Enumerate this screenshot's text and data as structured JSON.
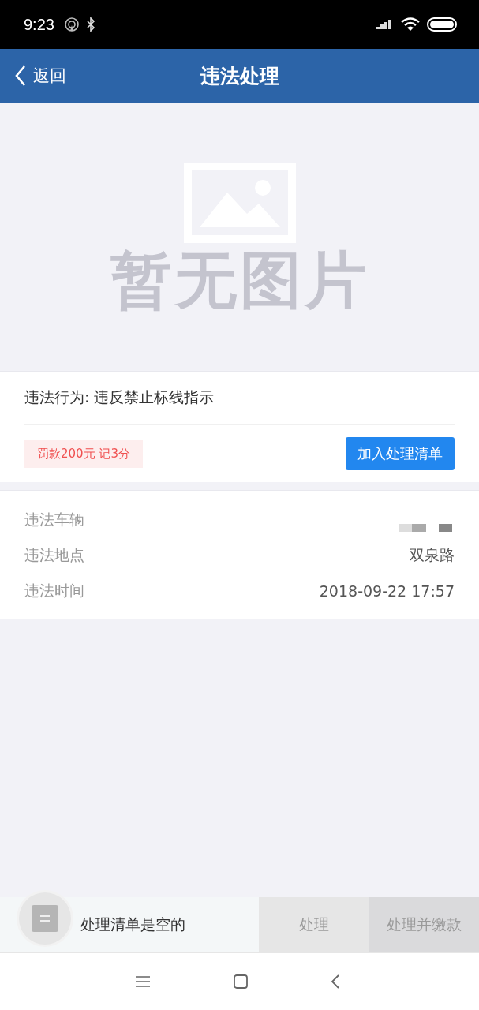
{
  "status_bar": {
    "time": "9:23"
  },
  "header": {
    "back_label": "返回",
    "title": "违法处理"
  },
  "image_placeholder": {
    "text": "暂无图片"
  },
  "violation": {
    "label": "违法行为:",
    "value": "违反禁止标线指示",
    "penalty": "罚款200元 记3分",
    "add_button": "加入处理清单"
  },
  "details": [
    {
      "label": "违法车辆",
      "kind": "redacted"
    },
    {
      "label": "违法地点",
      "kind": "text",
      "value": "双泉路"
    },
    {
      "label": "违法时间",
      "kind": "text",
      "value": "2018-09-22 17:57"
    }
  ],
  "bottom_bar": {
    "cart_text": "处理清单是空的",
    "buttons": [
      {
        "label": "处理",
        "disabled": true
      },
      {
        "label": "处理并缴款",
        "disabled": true
      }
    ]
  }
}
